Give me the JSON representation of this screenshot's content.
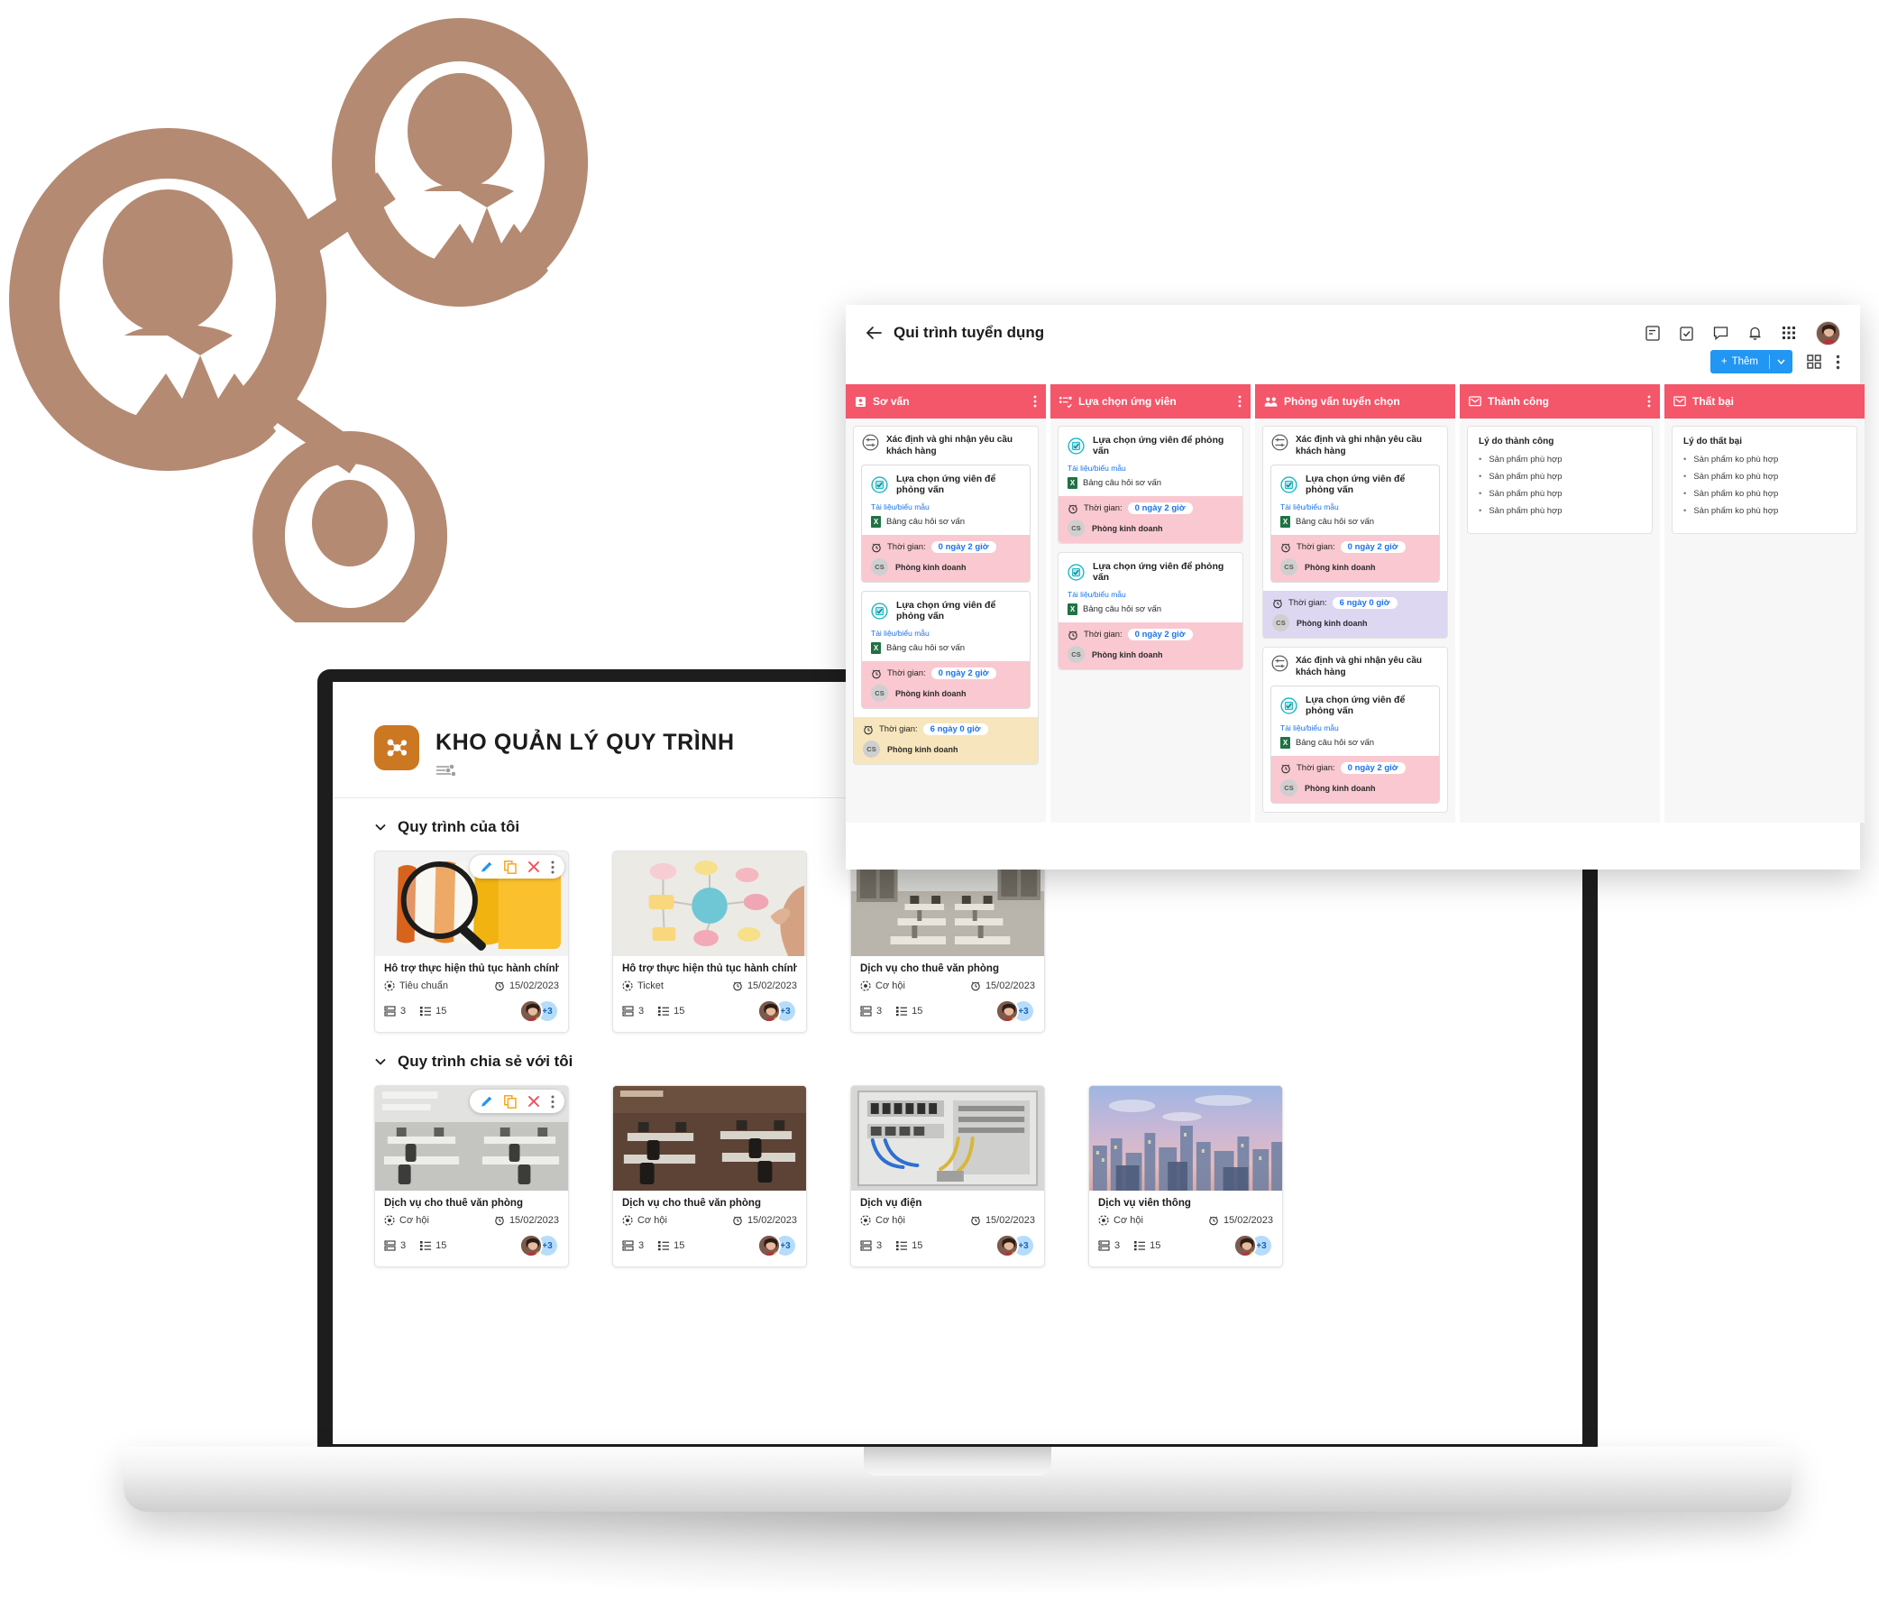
{
  "background": {
    "logo_color": "#b48a73",
    "icon_name": "people-network-icon"
  },
  "repository": {
    "app_title": "KHO QUẢN LÝ QUY TRÌNH",
    "logo_icon": "network-nodes-icon",
    "filter_icon": "filter-sliders-icon",
    "sections": [
      {
        "title": "Quy trình của tôi",
        "chevron_icon": "chevron-down-icon",
        "cards": [
          {
            "name": "Hỗ trợ thực hiện thủ tục hành chính",
            "type": "Tiêu chuẩn",
            "type_icon": "target-icon",
            "date": "15/02/2023",
            "date_icon": "alarm-clock-icon",
            "stage_count": "3",
            "stage_icon": "layers-icon",
            "task_count": "15",
            "task_icon": "list-icon",
            "avatar_extra": "+3",
            "thumb": "magnifier-folders",
            "has_actions": true
          },
          {
            "name": "Hỗ trợ thực hiện thủ tục hành chính",
            "type": "Ticket",
            "type_icon": "target-icon",
            "date": "15/02/2023",
            "date_icon": "alarm-clock-icon",
            "stage_count": "3",
            "stage_icon": "layers-icon",
            "task_count": "15",
            "task_icon": "list-icon",
            "avatar_extra": "+3",
            "thumb": "flowchart-sticky",
            "has_actions": false
          },
          {
            "name": "Dịch vụ cho thuê văn phòng",
            "type": "Cơ hội",
            "type_icon": "target-icon",
            "date": "15/02/2023",
            "date_icon": "alarm-clock-icon",
            "stage_count": "3",
            "stage_icon": "layers-icon",
            "task_count": "15",
            "task_icon": "list-icon",
            "avatar_extra": "+3",
            "thumb": "office-desks",
            "has_actions": false
          }
        ]
      },
      {
        "title": "Quy trình chia sẻ với tôi",
        "chevron_icon": "chevron-down-icon",
        "cards": [
          {
            "name": "Dịch vụ cho thuê văn phòng",
            "type": "Cơ hội",
            "type_icon": "target-icon",
            "date": "15/02/2023",
            "date_icon": "alarm-clock-icon",
            "stage_count": "3",
            "stage_icon": "layers-icon",
            "task_count": "15",
            "task_icon": "list-icon",
            "avatar_extra": "+3",
            "thumb": "office-bright",
            "has_actions": true
          },
          {
            "name": "Dịch vụ cho thuê văn phòng",
            "type": "Cơ hội",
            "type_icon": "target-icon",
            "date": "15/02/2023",
            "date_icon": "alarm-clock-icon",
            "stage_count": "3",
            "stage_icon": "layers-icon",
            "task_count": "15",
            "task_icon": "list-icon",
            "avatar_extra": "+3",
            "thumb": "office-dark",
            "has_actions": false
          },
          {
            "name": "Dịch vụ điện",
            "type": "Cơ hội",
            "type_icon": "target-icon",
            "date": "15/02/2023",
            "date_icon": "alarm-clock-icon",
            "stage_count": "3",
            "stage_icon": "layers-icon",
            "task_count": "15",
            "task_icon": "list-icon",
            "avatar_extra": "+3",
            "thumb": "electrical-panel",
            "has_actions": false
          },
          {
            "name": "Dịch vụ viễn thông",
            "type": "Cơ hội",
            "type_icon": "target-icon",
            "date": "15/02/2023",
            "date_icon": "alarm-clock-icon",
            "stage_count": "3",
            "stage_icon": "layers-icon",
            "task_count": "15",
            "task_icon": "list-icon",
            "avatar_extra": "+3",
            "thumb": "city-skyline",
            "has_actions": false
          }
        ]
      }
    ],
    "card_actions": {
      "edit_icon": "pencil-icon",
      "copy_icon": "copy-icon",
      "delete_icon": "close-x-icon",
      "more_icon": "more-vertical-icon"
    }
  },
  "kanban": {
    "back_icon": "arrow-left-icon",
    "title": "Qui trình tuyển dụng",
    "top_icons": [
      "note-icon",
      "task-check-icon",
      "chat-icon",
      "bell-icon",
      "apps-grid-icon"
    ],
    "toolbar": {
      "add_label": "Thêm",
      "add_plus": "+",
      "add_caret_icon": "chevron-down-icon",
      "grid_view_icon": "grid-view-icon",
      "more_icon": "more-vertical-icon",
      "accent_color": "#2196f3"
    },
    "header_color": "#f4566a",
    "columns": [
      {
        "title": "Sơ vấn",
        "icon": "contact-card-icon",
        "has_menu": true,
        "cards": [
          {
            "kind": "grouped",
            "header": "Xác định và ghi nhận yêu cầu khách hàng",
            "header_icon": "process-circle-icon",
            "blocks": [
              {
                "title": "Lựa chọn ứng viên để phỏng vấn",
                "title_icon": "check-circle-icon",
                "doc_label": "Tài liệu/biểu mẫu",
                "doc_name": "Bảng câu hỏi sơ vấn",
                "doc_icon": "excel-file-icon",
                "time_label": "Thời gian:",
                "time_value": "0 ngày 2 giờ",
                "time_icon": "alarm-clock-icon",
                "owner_initials": "CS",
                "owner_name": "Phòng kinh doanh",
                "band": "pink"
              },
              {
                "title": "Lựa chọn ứng viên để phỏng vấn",
                "title_icon": "check-circle-icon",
                "doc_label": "Tài liệu/biểu mẫu",
                "doc_name": "Bảng câu hỏi sơ vấn",
                "doc_icon": "excel-file-icon",
                "time_label": "Thời gian:",
                "time_value": "0 ngày 2 giờ",
                "time_icon": "alarm-clock-icon",
                "owner_initials": "CS",
                "owner_name": "Phòng kinh doanh",
                "band": "pink"
              }
            ],
            "footer": {
              "time_label": "Thời gian:",
              "time_value": "6 ngày 0 giờ",
              "time_icon": "alarm-clock-icon",
              "owner_initials": "CS",
              "owner_name": "Phòng kinh doanh",
              "band": "yellow"
            }
          }
        ]
      },
      {
        "title": "Lựa chọn ứng viên",
        "icon": "list-check-icon",
        "has_menu": true,
        "cards": [
          {
            "kind": "simple",
            "title": "Lựa chọn ứng viên để phỏng vấn",
            "title_icon": "check-circle-icon",
            "doc_label": "Tài liệu/biểu mẫu",
            "doc_name": "Bảng câu hỏi sơ vấn",
            "doc_icon": "excel-file-icon",
            "time_label": "Thời gian:",
            "time_value": "0 ngày 2 giờ",
            "time_icon": "alarm-clock-icon",
            "owner_initials": "CS",
            "owner_name": "Phòng kinh doanh",
            "band": "pink"
          },
          {
            "kind": "simple",
            "title": "Lựa chọn ứng viên để phỏng vấn",
            "title_icon": "check-circle-icon",
            "doc_label": "Tài liệu/biểu mẫu",
            "doc_name": "Bảng câu hỏi sơ vấn",
            "doc_icon": "excel-file-icon",
            "time_label": "Thời gian:",
            "time_value": "0 ngày 2 giờ",
            "time_icon": "alarm-clock-icon",
            "owner_initials": "CS",
            "owner_name": "Phòng kinh doanh",
            "band": "pink"
          }
        ]
      },
      {
        "title": "Phỏng vấn tuyển chọn",
        "icon": "people-icon",
        "has_menu": false,
        "cards": [
          {
            "kind": "grouped",
            "header": "Xác định và ghi nhận yêu cầu khách hàng",
            "header_icon": "process-circle-icon",
            "blocks": [
              {
                "title": "Lựa chọn ứng viên để phỏng vấn",
                "title_icon": "check-circle-icon",
                "doc_label": "Tài liệu/biểu mẫu",
                "doc_name": "Bảng câu hỏi sơ vấn",
                "doc_icon": "excel-file-icon",
                "time_label": "Thời gian:",
                "time_value": "0 ngày 2 giờ",
                "time_icon": "alarm-clock-icon",
                "owner_initials": "CS",
                "owner_name": "Phòng kinh doanh",
                "band": "pink"
              }
            ],
            "footer": {
              "time_label": "Thời gian:",
              "time_value": "6 ngày 0 giờ",
              "time_icon": "alarm-clock-icon",
              "owner_initials": "CS",
              "owner_name": "Phòng kinh doanh",
              "band": "purple"
            }
          },
          {
            "kind": "grouped",
            "header": "Xác định và ghi nhận yêu cầu khách hàng",
            "header_icon": "process-circle-icon",
            "blocks": [
              {
                "title": "Lựa chọn ứng viên để phỏng vấn",
                "title_icon": "check-circle-icon",
                "doc_label": "Tài liệu/biểu mẫu",
                "doc_name": "Bảng câu hỏi sơ vấn",
                "doc_icon": "excel-file-icon",
                "time_label": "Thời gian:",
                "time_value": "0 ngày 2 giờ",
                "time_icon": "alarm-clock-icon",
                "owner_initials": "CS",
                "owner_name": "Phòng kinh doanh",
                "band": "pink"
              }
            ],
            "footer": null
          }
        ]
      },
      {
        "title": "Thành công",
        "icon": "envelope-check-icon",
        "has_menu": true,
        "reason_card": {
          "title": "Lý do thành công",
          "items": [
            "Sản phẩm phù hợp",
            "Sản phẩm phù hợp",
            "Sản phẩm phù hợp",
            "Sản phẩm phù hợp"
          ]
        }
      },
      {
        "title": "Thất bại",
        "icon": "envelope-x-icon",
        "has_menu": false,
        "reason_card": {
          "title": "Lý do thất bại",
          "items": [
            "Sản phẩm ko phù hợp",
            "Sản phẩm ko phù hợp",
            "Sản phẩm ko phù hợp",
            "Sản phẩm ko phù hợp"
          ]
        }
      }
    ]
  }
}
